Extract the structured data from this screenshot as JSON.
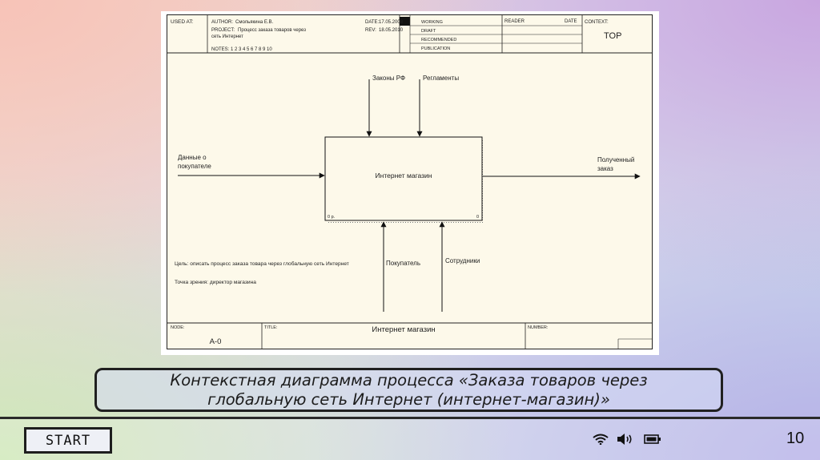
{
  "diagram": {
    "header": {
      "used_at": "USED AT:",
      "author_label": "AUTHOR:",
      "author_value": "Смольякина Е.В.",
      "project_label": "PROJECT:",
      "project_value_1": "Процесс заказа товаров через",
      "project_value_2": "сеть Интернет",
      "date_label": "DATE:",
      "date_value": "17.05.2008",
      "rev_label": "REV:",
      "rev_value": "18.05.2010",
      "notes": "NOTES:  1  2  3  4  5  6  7  8  9  10",
      "status": [
        "WORKING",
        "DRAFT",
        "RECOMMENDED",
        "PUBLICATION"
      ],
      "reader_label": "READER",
      "reader_date_label": "DATE",
      "context_label": "CONTEXT:",
      "context_value": "TOP"
    },
    "box": {
      "label": "Интернет магазин",
      "corner_left": "0 р.",
      "corner_right": "0"
    },
    "arrows": {
      "control_1": "Законы РФ",
      "control_2": "Регламенты",
      "input_1": "Данные о",
      "input_2": "покупателе",
      "output_1": "Полученный",
      "output_2": "заказ",
      "mechanism_1": "Покупатель",
      "mechanism_2": "Сотрудники"
    },
    "purpose": "Цель: описать процесс заказа товара через глобальную сеть Интернет",
    "viewpoint": "Точка зрения: директор магазина",
    "footer": {
      "node_label": "NODE:",
      "node_value": "А-0",
      "title_label": "TITLE:",
      "title_value": "Интернет магазин",
      "number_label": "NUMBER:"
    }
  },
  "caption": {
    "line1": "Контекстная диаграмма процесса «Заказа товаров через",
    "line2": "глобальную сеть Интернет (интернет-магазин)»"
  },
  "footer_bar": {
    "start_label": "START",
    "page_number": "10",
    "tray_icons": [
      "wifi-icon",
      "speaker-icon",
      "battery-icon"
    ]
  }
}
